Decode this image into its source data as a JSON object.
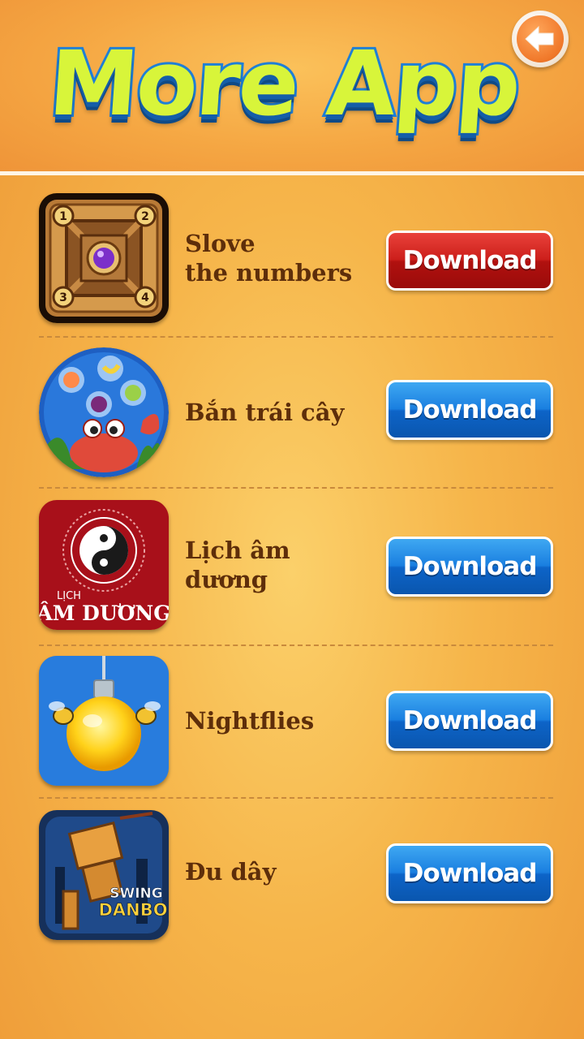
{
  "header": {
    "title": "More App",
    "back_icon": "back-arrow-icon"
  },
  "apps": [
    {
      "name": "Slove\nthe numbers",
      "button": "Download",
      "button_color": "#c41a16",
      "icon": "puzzle-board-icon"
    },
    {
      "name": "Bắn trái cây",
      "button": "Download",
      "button_color": "#1a7fe0",
      "icon": "fruit-crab-icon"
    },
    {
      "name": "Lịch âm dương",
      "button": "Download",
      "button_color": "#1a7fe0",
      "icon": "yin-yang-calendar-icon",
      "icon_text_top": "LỊCH",
      "icon_text_bottom": "ÂM DƯƠNG"
    },
    {
      "name": "Nightflies",
      "button": "Download",
      "button_color": "#1a7fe0",
      "icon": "lightbulb-fireflies-icon"
    },
    {
      "name": "Đu dây",
      "button": "Download",
      "button_color": "#1a7fe0",
      "icon": "swing-danbo-icon",
      "icon_text_top": "SWING",
      "icon_text_bottom": "DANBO"
    }
  ]
}
